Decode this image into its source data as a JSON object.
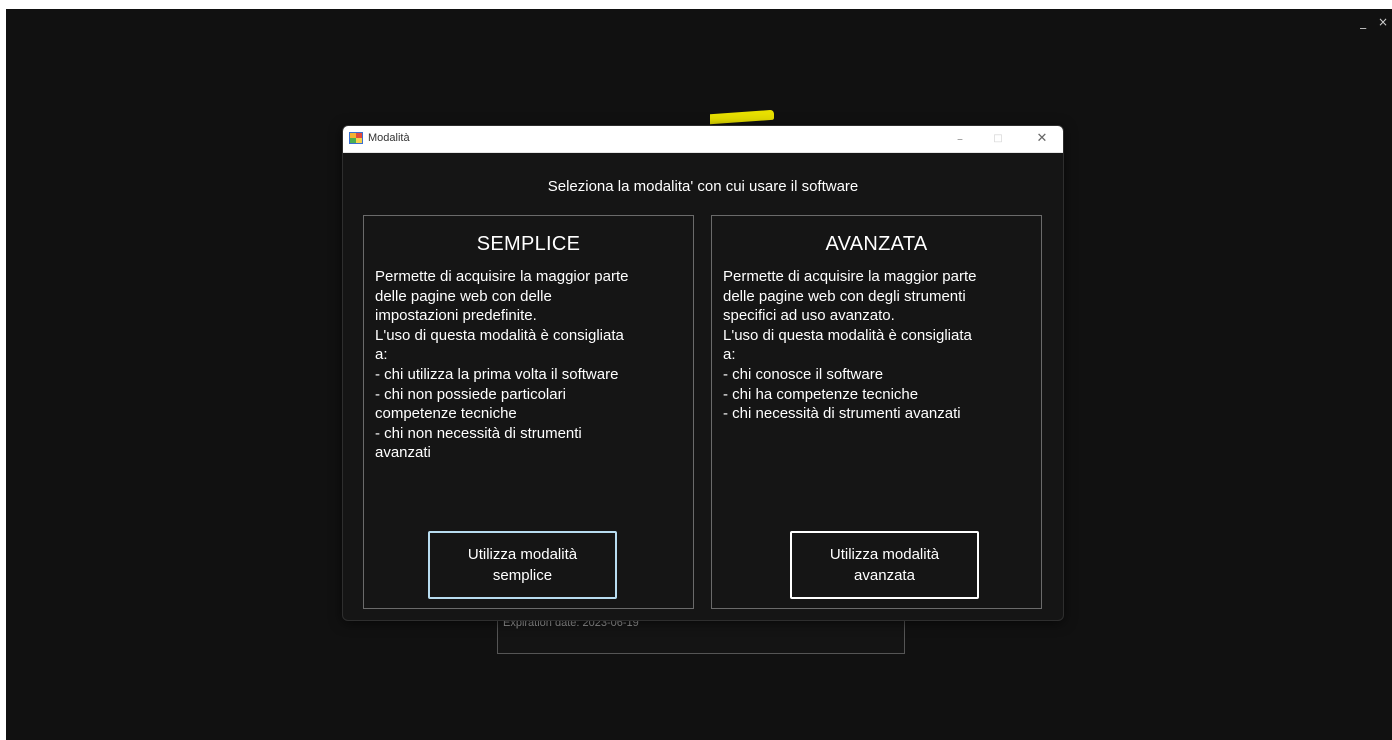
{
  "screen": {
    "controls": {
      "minimize": "_",
      "close": "×"
    }
  },
  "background": {
    "license": {
      "expiration": "Expiration date: 2023-06-19"
    }
  },
  "dialog": {
    "title": "Modalità",
    "controls": {
      "minimize": "–",
      "maximize": "□",
      "close": "✕"
    },
    "heading": "Seleziona la modalita' con cui usare il software",
    "modes": [
      {
        "title": "SEMPLICE",
        "description": "Permette di acquisire la maggior parte\ndelle pagine web con delle\nimpostazioni predefinite.\nL'uso di questa modalità è consigliata\na:\n- chi utilizza la prima volta il software\n- chi non possiede particolari\ncompetenze tecniche\n- chi non necessità di strumenti\navanzati",
        "button": "Utilizza modalità\nsemplice"
      },
      {
        "title": "AVANZATA",
        "description": "Permette di acquisire la maggior parte\ndelle pagine web con degli strumenti\nspecifici ad uso avanzato.\nL'uso di questa modalità è consigliata\na:\n- chi conosce il software\n- chi ha competenze tecniche\n- chi necessità di strumenti avanzati",
        "button": "Utilizza modalità\navanzata"
      }
    ]
  },
  "colors": {
    "background": "#111111",
    "dialog": "#151515",
    "accent_yellow": "#e8e000",
    "focus_border": "#b8dcf0"
  }
}
